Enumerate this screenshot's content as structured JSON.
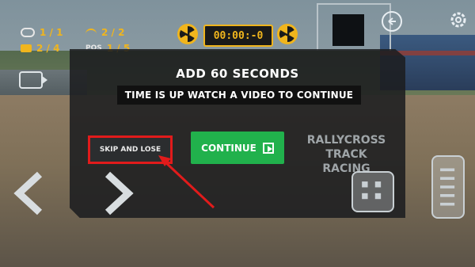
{
  "hud": {
    "lap": "1 / 1",
    "timer_lap": "2 / 2",
    "checkpoint": "2 / 4",
    "pos_label": "POS",
    "position": "1 / 5",
    "race_timer": "00:00:-0"
  },
  "dialog": {
    "title": "ADD 60 SECONDS",
    "subtitle": "TIME IS UP WATCH A VIDEO TO CONTINUE",
    "skip_label": "SKIP AND LOSE",
    "continue_label": "CONTINUE",
    "watermark": "RALLYCROSS TRACK RACING"
  },
  "colors": {
    "accent_yellow": "#f0b51d",
    "continue_green": "#21b14c",
    "highlight_red": "#e11b1b"
  },
  "icons": [
    "lap-icon",
    "lap-timer-icon",
    "checkpoint-flag-icon",
    "camera-icon",
    "radiation-icon",
    "back-icon",
    "settings-gear-icon",
    "play-icon",
    "steer-left-icon",
    "steer-right-icon",
    "brake-pedal-icon",
    "gas-pedal-icon"
  ]
}
